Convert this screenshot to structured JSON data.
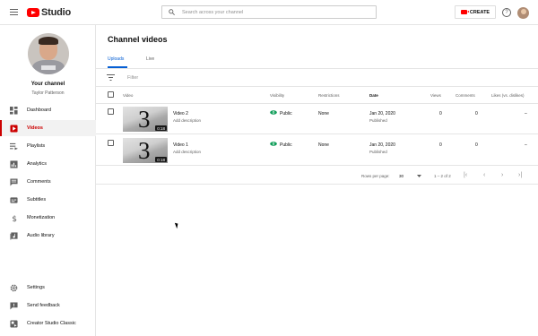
{
  "app": {
    "brand": "Studio"
  },
  "search": {
    "placeholder": "Search across your channel"
  },
  "header": {
    "create_label": "CREATE"
  },
  "channel": {
    "title": "Your channel",
    "name": "Taylor Patterson"
  },
  "sidebar": {
    "items": [
      {
        "label": "Dashboard",
        "icon": "dashboard-icon"
      },
      {
        "label": "Videos",
        "icon": "videos-icon",
        "active": true
      },
      {
        "label": "Playlists",
        "icon": "playlists-icon"
      },
      {
        "label": "Analytics",
        "icon": "analytics-icon"
      },
      {
        "label": "Comments",
        "icon": "comments-icon"
      },
      {
        "label": "Subtitles",
        "icon": "subtitles-icon"
      },
      {
        "label": "Monetization",
        "icon": "monetization-icon"
      },
      {
        "label": "Audio library",
        "icon": "audio-library-icon"
      }
    ],
    "bottom_items": [
      {
        "label": "Settings",
        "icon": "gear-icon"
      },
      {
        "label": "Send feedback",
        "icon": "feedback-icon"
      },
      {
        "label": "Creator Studio Classic",
        "icon": "classic-icon"
      }
    ]
  },
  "main": {
    "title": "Channel videos",
    "tabs": [
      {
        "label": "Uploads",
        "active": true
      },
      {
        "label": "Live"
      }
    ],
    "filter_placeholder": "Filter",
    "columns": [
      "Video",
      "Visibility",
      "Restrictions",
      "Date",
      "Views",
      "Comments",
      "Likes (vs. dislikes)"
    ],
    "rows": [
      {
        "title": "Video 2",
        "description": "Add description",
        "thumb_number": "3",
        "duration": "0:18",
        "visibility": "Public",
        "restrictions": "None",
        "date": "Jan 20, 2020",
        "date_status": "Published",
        "views": "0",
        "comments": "0",
        "likes": "–"
      },
      {
        "title": "Video 1",
        "description": "Add description",
        "thumb_number": "3",
        "duration": "0:18",
        "visibility": "Public",
        "restrictions": "None",
        "date": "Jan 20, 2020",
        "date_status": "Published",
        "views": "0",
        "comments": "0",
        "likes": "–"
      }
    ],
    "pagination": {
      "rows_per_page_label": "Rows per page:",
      "rows_per_page": "30",
      "range": "1 – 2 of 2"
    }
  },
  "colors": {
    "accent": "#065fd4",
    "active_nav": "#cc0000",
    "public_eye": "#0f9d58",
    "brand_red": "#ff0000"
  }
}
